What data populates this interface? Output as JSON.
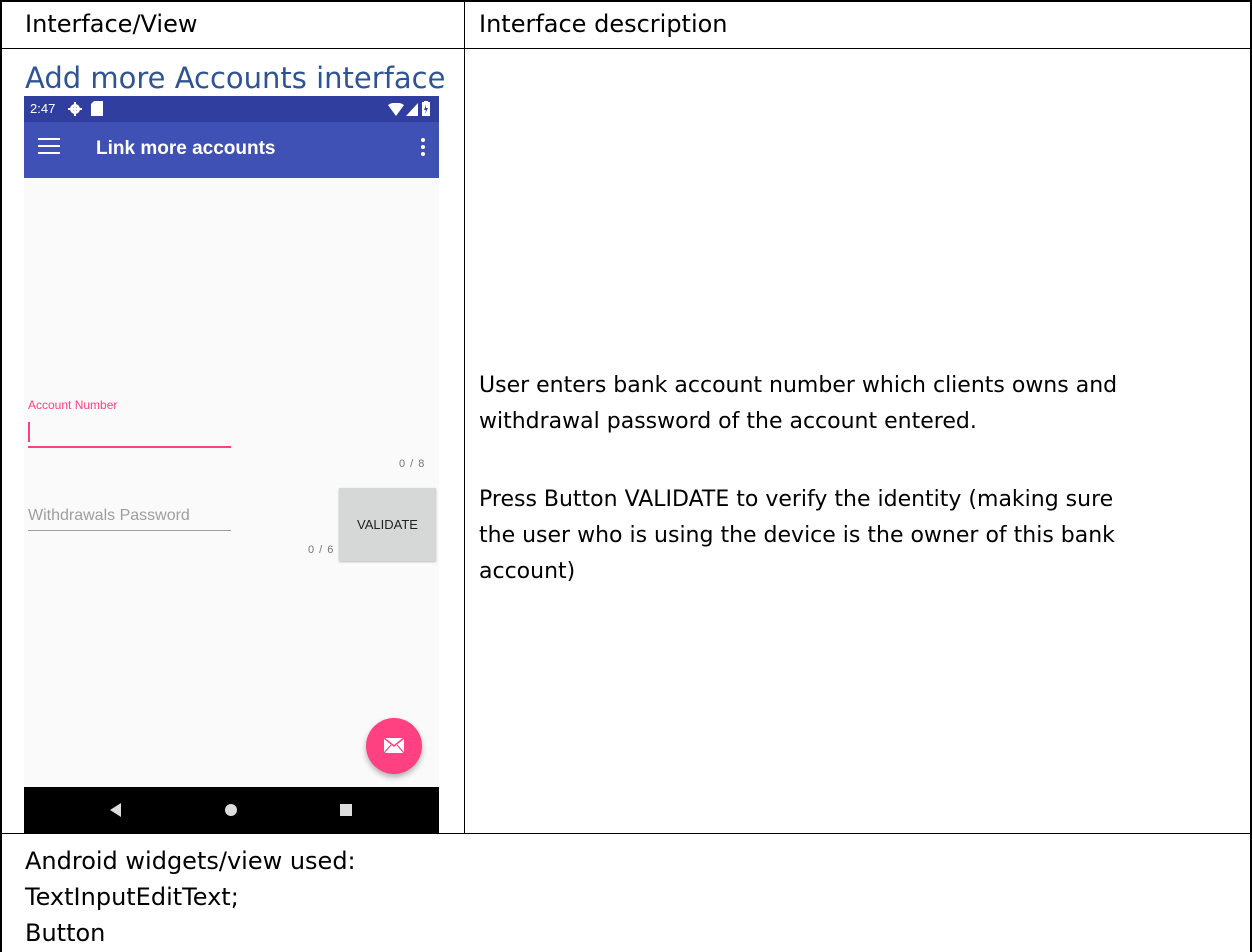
{
  "table": {
    "header_left": "Interface/View",
    "header_right": "Interface description",
    "section_title": "Add more Accounts interface",
    "description_p1_line1": "User enters bank account number which clients owns and",
    "description_p1_line2": "withdrawal password of the account entered.",
    "description_p2_line1": "Press Button VALIDATE to verify the identity (making sure",
    "description_p2_line2": "the user who is using the device is the owner of this bank",
    "description_p2_line3": "account)",
    "footer_line1": "Android widgets/view used:",
    "footer_line2": "TextInputEditText;",
    "footer_line3": "Button"
  },
  "phone": {
    "status": {
      "time": "2:47",
      "icons": [
        "gear-icon",
        "sd-card-icon",
        "wifi-icon",
        "signal-icon",
        "battery-icon"
      ]
    },
    "appbar": {
      "title": "Link more accounts",
      "menu_icon": "hamburger-icon",
      "overflow_icon": "more-vert-icon"
    },
    "account_field": {
      "label": "Account Number",
      "value": "",
      "counter": "0 / 8"
    },
    "password_field": {
      "placeholder": "Withdrawals Password",
      "value": "",
      "counter": "0 / 6"
    },
    "validate_button": {
      "label": "VALIDATE"
    },
    "fab": {
      "icon": "mail-icon"
    },
    "nav": {
      "icons": [
        "back-icon",
        "home-icon",
        "recents-icon"
      ]
    },
    "colors": {
      "primary": "#3f51b5",
      "primary_dark": "#303f9f",
      "accent": "#ff4081"
    }
  }
}
